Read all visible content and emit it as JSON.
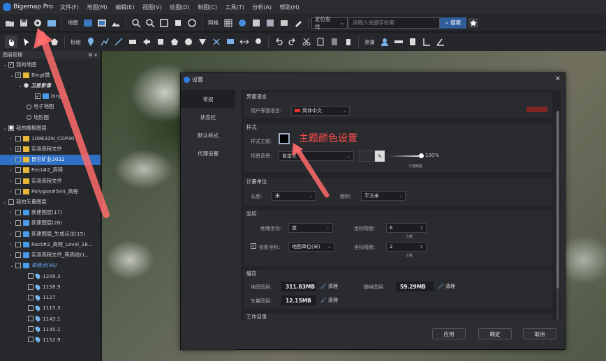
{
  "app": {
    "name": "Bigemap Pro",
    "menu": [
      "文件(F)",
      "地图(M)",
      "编辑(E)",
      "视图(V)",
      "绘图(D)",
      "制图(C)",
      "工具(T)",
      "分析(A)",
      "帮助(H)"
    ]
  },
  "toolbar1": {
    "map_label": "地图",
    "grid_label": "网格",
    "locate_select": "定位查找",
    "search_placeholder": "请输入关键字检索",
    "search_button": "搜索"
  },
  "toolbar2": {
    "annotate_label": "标绘",
    "measure_label": "测量"
  },
  "layers_panel": {
    "title": "图层管理",
    "rows": [
      {
        "label": "我的地图"
      },
      {
        "label": "Bing(微"
      },
      {
        "label": "卫星影像"
      },
      {
        "label": "bing卫"
      },
      {
        "label": "电子地图"
      },
      {
        "label": "地形图"
      },
      {
        "label": "我的栅格图层"
      },
      {
        "label": "109E33N_COP30"
      },
      {
        "label": "实测高程文件"
      },
      {
        "label": "昆仑矿业2022"
      },
      {
        "label": "Rect#2_高程"
      },
      {
        "label": "实测高程文件"
      },
      {
        "label": "Polygon#544_高程"
      },
      {
        "label": "我的矢量图层"
      },
      {
        "label": "新建图层(17)"
      },
      {
        "label": "新建图层(28)"
      },
      {
        "label": "新建图层_生成点位(15)"
      },
      {
        "label": "Rect#2_高程_Level_16..."
      },
      {
        "label": "实测高程文件_等高线(1..."
      },
      {
        "label": "高程点(48)"
      },
      {
        "label": "1209.3"
      },
      {
        "label": "1158.9"
      },
      {
        "label": "1127"
      },
      {
        "label": "1115.3"
      },
      {
        "label": "1143.1"
      },
      {
        "label": "1145.1"
      },
      {
        "label": "1152.9"
      }
    ]
  },
  "dialog": {
    "title": "设置",
    "side_items": [
      "常规",
      "状态栏",
      "默认样式",
      "代理设置"
    ],
    "lang": {
      "section": "界面语言",
      "label": "用户界面语言:",
      "value": "简体中文"
    },
    "style": {
      "section": "样式",
      "theme_label": "样式主题:",
      "bg_label": "场景背景:",
      "bg_value": "自定义",
      "opacity": "100%",
      "opacity_note": "不透明度"
    },
    "units": {
      "section": "计量单位",
      "length_label": "长度:",
      "length_value": "米",
      "area_label": "面积:",
      "area_value": "平方米"
    },
    "coords": {
      "section": "坐标",
      "geo_label": "地理坐标:",
      "geo_value": "度",
      "geo_prec_label": "坐标精度:",
      "geo_prec_value": "6",
      "proj_label": "投影坐标:",
      "proj_value": "地图单位(米)",
      "proj_prec_label": "坐标精度:",
      "proj_prec_value": "2",
      "decimals_note": "小数"
    },
    "cache": {
      "section": "缓存",
      "map_label": "地图图层:",
      "map_value": "311.83MB",
      "raster_label": "栅格图层:",
      "raster_value": "59.29MB",
      "vector_label": "矢量图层:",
      "vector_value": "12.15MB",
      "clear": "清理"
    },
    "workdir": {
      "section": "工作目录"
    },
    "buttons": {
      "apply": "应用",
      "ok": "确定",
      "cancel": "取消"
    }
  },
  "annotation": {
    "text": "主题颜色设置",
    "color": "#ff4d4d"
  }
}
